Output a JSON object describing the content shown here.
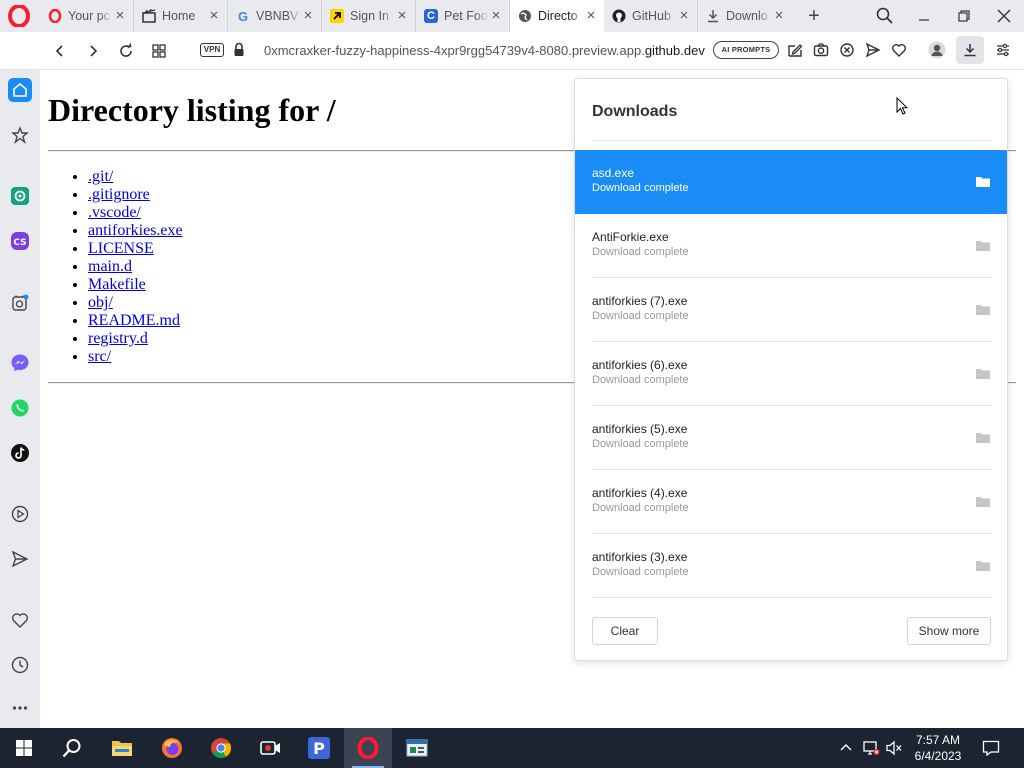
{
  "browser": {
    "tabs": [
      {
        "title": "Your pc",
        "favicon": "opera-icon",
        "active": false
      },
      {
        "title": "Home",
        "favicon": "clapperboard-icon",
        "active": false
      },
      {
        "title": "VBNBV",
        "favicon": "google-icon",
        "active": false
      },
      {
        "title": "Sign In",
        "favicon": "arrow-logo-icon",
        "active": false
      },
      {
        "title": "Pet Foo",
        "favicon": "c-logo-icon",
        "active": false
      },
      {
        "title": "Directo",
        "favicon": "globe-icon",
        "active": true
      },
      {
        "title": "GitHub",
        "favicon": "github-icon",
        "active": false
      },
      {
        "title": "Downlo",
        "favicon": "download-icon",
        "active": false
      }
    ],
    "new_tab_label": "+",
    "address": {
      "vpn_label": "VPN",
      "url_prefix": "0xmcraxker-fuzzy-happiness-4xpr9rgg54739v4-8080.preview.app.",
      "url_host": "github.dev",
      "ai_prompts_label": "AI PROMPTS"
    }
  },
  "page": {
    "heading": "Directory listing for /",
    "files": [
      ".git/",
      ".gitignore",
      ".vscode/",
      "antiforkies.exe",
      "LICENSE",
      "main.d",
      "Makefile",
      "obj/",
      "README.md",
      "registry.d",
      "src/"
    ]
  },
  "downloads": {
    "title": "Downloads",
    "items": [
      {
        "name": "asd.exe",
        "status": "Download complete",
        "selected": true
      },
      {
        "name": "AntiForkie.exe",
        "status": "Download complete",
        "selected": false
      },
      {
        "name": "antiforkies (7).exe",
        "status": "Download complete",
        "selected": false
      },
      {
        "name": "antiforkies (6).exe",
        "status": "Download complete",
        "selected": false
      },
      {
        "name": "antiforkies (5).exe",
        "status": "Download complete",
        "selected": false
      },
      {
        "name": "antiforkies (4).exe",
        "status": "Download complete",
        "selected": false
      },
      {
        "name": "antiforkies (3).exe",
        "status": "Download complete",
        "selected": false
      }
    ],
    "clear_label": "Clear",
    "show_more_label": "Show more"
  },
  "taskbar": {
    "time": "7:57 AM",
    "date": "6/4/2023"
  },
  "colors": {
    "accent": "#1a8cf6",
    "opera_red": "#ff1b2d",
    "link": "#0000ee",
    "taskbar": "#1b2430"
  }
}
